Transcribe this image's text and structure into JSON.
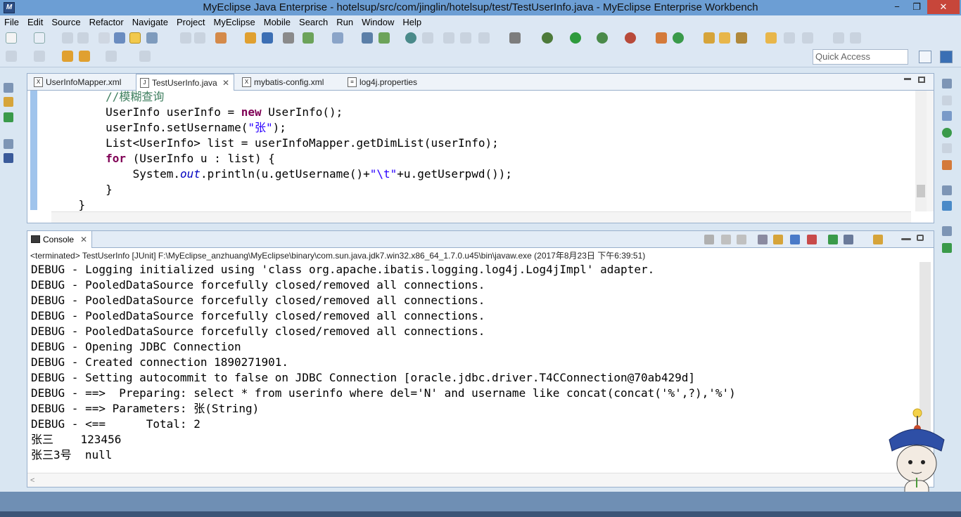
{
  "window": {
    "title": "MyEclipse Java Enterprise - hotelsup/src/com/jinglin/hotelsup/test/TestUserInfo.java - MyEclipse Enterprise Workbench",
    "min": "−",
    "max": "❐",
    "close": "✕"
  },
  "menu": [
    "File",
    "Edit",
    "Source",
    "Refactor",
    "Navigate",
    "Project",
    "MyEclipse",
    "Mobile",
    "Search",
    "Run",
    "Window",
    "Help"
  ],
  "quick_access": "Quick Access",
  "editor": {
    "tabs": [
      {
        "label": "UserInfoMapper.xml",
        "icon": "X"
      },
      {
        "label": "TestUserInfo.java",
        "icon": "J",
        "close": "✕"
      },
      {
        "label": "mybatis-config.xml",
        "icon": "X"
      },
      {
        "label": "log4j.properties",
        "icon": "≡"
      }
    ],
    "lines": [
      {
        "indent": "        ",
        "parts": [
          {
            "t": "//模糊查询",
            "c": "cm"
          }
        ]
      },
      {
        "indent": "        ",
        "parts": [
          {
            "t": "UserInfo userInfo = ",
            "c": ""
          },
          {
            "t": "new",
            "c": "kw"
          },
          {
            "t": " UserInfo();",
            "c": ""
          }
        ]
      },
      {
        "indent": "        ",
        "parts": [
          {
            "t": "userInfo.setUsername(",
            "c": ""
          },
          {
            "t": "\"张\"",
            "c": "str"
          },
          {
            "t": ");",
            "c": ""
          }
        ]
      },
      {
        "indent": "        ",
        "parts": [
          {
            "t": "List<UserInfo> list = userInfoMapper.getDimList(userInfo);",
            "c": ""
          }
        ]
      },
      {
        "indent": "        ",
        "parts": [
          {
            "t": "for",
            "c": "kw"
          },
          {
            "t": " (UserInfo u : list) {",
            "c": ""
          }
        ]
      },
      {
        "indent": "            ",
        "parts": [
          {
            "t": "System.",
            "c": ""
          },
          {
            "t": "out",
            "c": "it"
          },
          {
            "t": ".println(u.getUsername()+",
            "c": ""
          },
          {
            "t": "\"\\t\"",
            "c": "str"
          },
          {
            "t": "+u.getUserpwd());",
            "c": ""
          }
        ]
      },
      {
        "indent": "        ",
        "parts": [
          {
            "t": "}",
            "c": ""
          }
        ]
      },
      {
        "indent": "    ",
        "parts": [
          {
            "t": "}",
            "c": ""
          }
        ]
      }
    ]
  },
  "console": {
    "tab_label": "Console",
    "tab_close": "✕",
    "status": "<terminated> TestUserInfo [JUnit] F:\\MyEclipse_anzhuang\\MyEclipse\\binary\\com.sun.java.jdk7.win32.x86_64_1.7.0.u45\\bin\\javaw.exe (2017年8月23日 下午6:39:51)",
    "output": [
      "DEBUG - Logging initialized using 'class org.apache.ibatis.logging.log4j.Log4jImpl' adapter.",
      "DEBUG - PooledDataSource forcefully closed/removed all connections.",
      "DEBUG - PooledDataSource forcefully closed/removed all connections.",
      "DEBUG - PooledDataSource forcefully closed/removed all connections.",
      "DEBUG - PooledDataSource forcefully closed/removed all connections.",
      "DEBUG - Opening JDBC Connection",
      "DEBUG - Created connection 1890271901.",
      "DEBUG - Setting autocommit to false on JDBC Connection [oracle.jdbc.driver.T4CConnection@70ab429d]",
      "DEBUG - ==>  Preparing: select * from userinfo where del='N' and username like concat(concat('%',?),'%')",
      "DEBUG - ==> Parameters: 张(String)",
      "DEBUG - <==      Total: 2",
      "张三    123456",
      "张三3号  null"
    ]
  },
  "colors": {
    "title_bar": "#6c9ed4",
    "keyword": "#7f0055",
    "string": "#2a00ff",
    "comment": "#3f7f5f",
    "static_field": "#0000c0"
  }
}
